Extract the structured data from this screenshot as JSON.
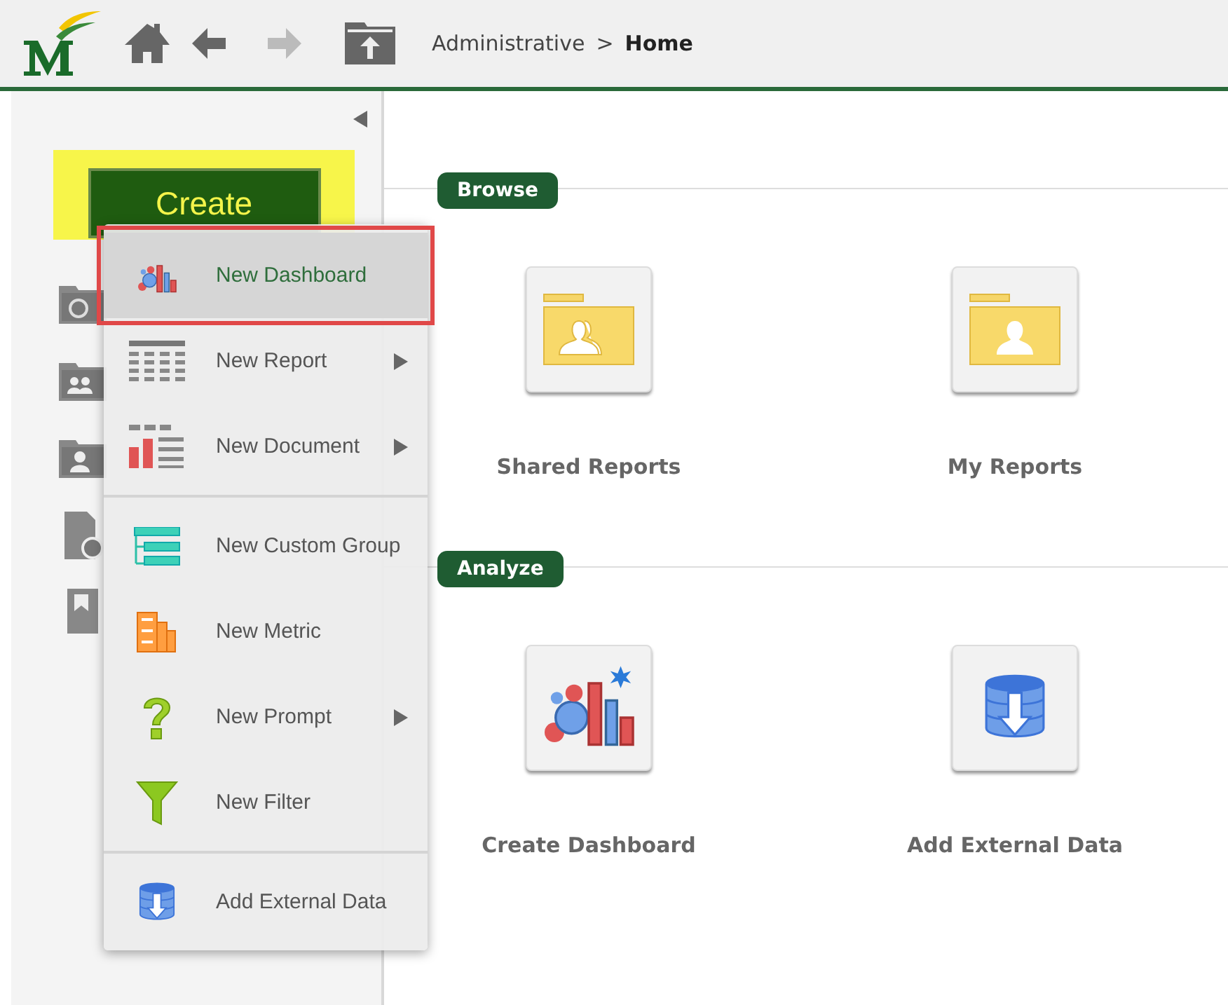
{
  "toolbar": {
    "breadcrumb": [
      {
        "label": "Administrative",
        "current": false
      },
      {
        "label": "Home",
        "current": true
      }
    ],
    "separator": ">"
  },
  "sidebar": {
    "create_button": "Create"
  },
  "create_menu": {
    "groups": [
      [
        {
          "label": "New Dashboard",
          "selected": true,
          "submenu": false
        },
        {
          "label": "New Report",
          "selected": false,
          "submenu": true
        },
        {
          "label": "New Document",
          "selected": false,
          "submenu": true
        }
      ],
      [
        {
          "label": "New Custom Group",
          "selected": false,
          "submenu": false
        },
        {
          "label": "New Metric",
          "selected": false,
          "submenu": false
        },
        {
          "label": "New Prompt",
          "selected": false,
          "submenu": true
        },
        {
          "label": "New Filter",
          "selected": false,
          "submenu": false
        }
      ],
      [
        {
          "label": "Add External Data",
          "selected": false,
          "submenu": false
        }
      ]
    ]
  },
  "sections": [
    {
      "title": "Browse",
      "tiles": [
        {
          "label": "Shared Reports"
        },
        {
          "label": "My Reports"
        }
      ]
    },
    {
      "title": "Analyze",
      "tiles": [
        {
          "label": "Create Dashboard"
        },
        {
          "label": "Add External Data"
        }
      ]
    }
  ]
}
